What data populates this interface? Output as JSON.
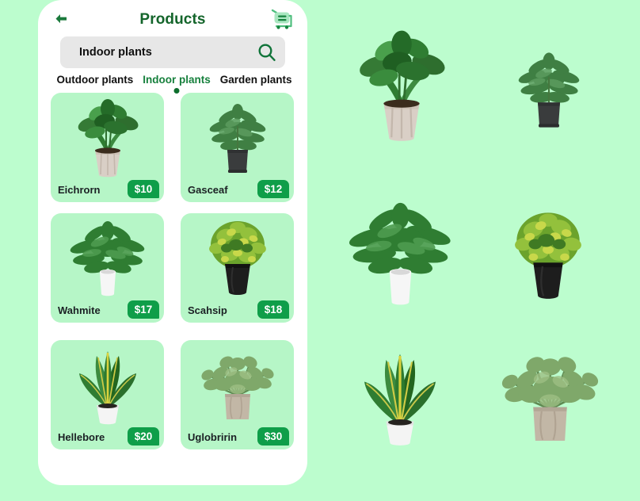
{
  "theme": {
    "page_background": "#bcfdce",
    "panel_background": "#ffffff",
    "card_background": "#b6f6c7",
    "accent_green": "#0f9e49",
    "title_green": "#14652b",
    "active_tab_green": "#17803d",
    "search_background": "#e7e7e7"
  },
  "header": {
    "title": "Products",
    "back_icon": "arrow-left-icon",
    "cart_icon": "shopping-cart-icon"
  },
  "search": {
    "value": "Indoor plants",
    "placeholder": "Indoor plants",
    "icon": "search-icon"
  },
  "tabs": [
    {
      "label": "Outdoor plants",
      "active": false
    },
    {
      "label": "Indoor plants",
      "active": true
    },
    {
      "label": "Garden plants",
      "active": false
    }
  ],
  "products": [
    {
      "name": "Eichrorn",
      "price": "$10",
      "image": "rubber-plant-in-ribbed-stone-pot"
    },
    {
      "name": "Gasceaf",
      "price": "$12",
      "image": "leafy-shrub-in-dark-square-pot"
    },
    {
      "name": "Wahmite",
      "price": "$17",
      "image": "broad-leaf-plant-in-white-pot"
    },
    {
      "name": "Scahsip",
      "price": "$18",
      "image": "yellow-green-bush-in-black-pot"
    },
    {
      "name": "Hellebore",
      "price": "$20",
      "image": "croton-plant-in-white-pot"
    },
    {
      "name": "Uglobririn",
      "price": "$30",
      "image": "rosemary-shrub-in-stone-pot"
    }
  ],
  "gallery": [
    {
      "label": "rubber-plant-in-ribbed-stone-pot"
    },
    {
      "label": "leafy-shrub-in-dark-square-pot"
    },
    {
      "label": "broad-leaf-plant-in-white-pot"
    },
    {
      "label": "yellow-green-bush-in-black-pot"
    },
    {
      "label": "croton-plant-in-white-pot"
    },
    {
      "label": "rosemary-shrub-in-stone-pot"
    }
  ]
}
